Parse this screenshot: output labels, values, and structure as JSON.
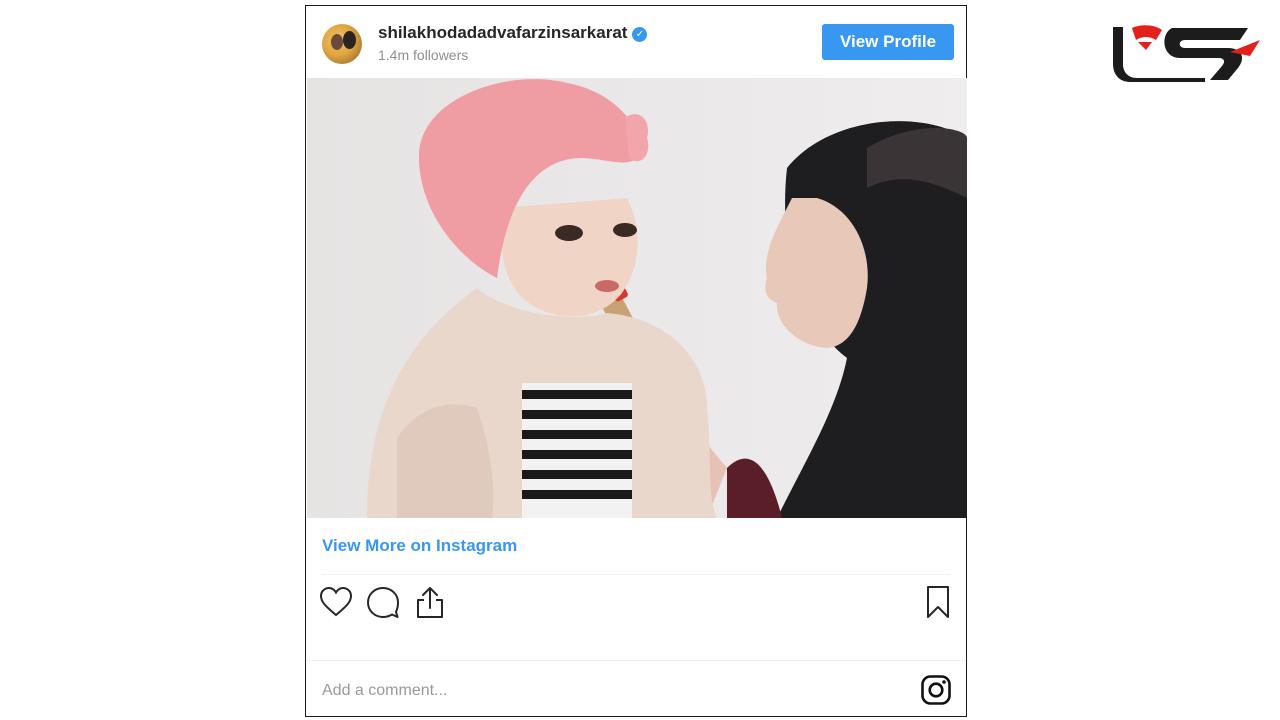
{
  "post": {
    "username": "shilakhodadadvafarzinsarkarat",
    "verified_icon": "verified-check-icon",
    "followers": "1.4m followers",
    "view_profile_label": "View Profile",
    "view_more_label": "View More on Instagram",
    "comment_placeholder": "Add a comment...",
    "photo_description": "photo"
  },
  "icons": {
    "like": "heart-icon",
    "comment": "comment-bubble-icon",
    "share": "share-icon",
    "save": "bookmark-icon",
    "instagram": "instagram-icon",
    "logo": "site-logo"
  },
  "colors": {
    "accent": "#3897f0",
    "text": "#262626",
    "muted": "#8e8e8e",
    "logo_red": "#e3201b",
    "logo_dark": "#1c1c1c"
  }
}
